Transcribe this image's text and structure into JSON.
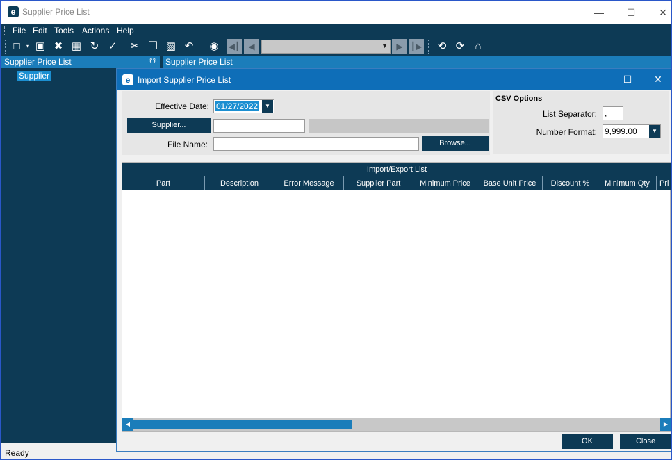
{
  "window": {
    "title": "Supplier Price List",
    "logo": "e"
  },
  "menu": [
    "File",
    "Edit",
    "Tools",
    "Actions",
    "Help"
  ],
  "panels": {
    "left": "Supplier Price List",
    "right": "Supplier Price List"
  },
  "tree": {
    "node": "Supplier"
  },
  "status": "Ready",
  "dialog": {
    "title": "Import Supplier Price List",
    "effective_date_label": "Effective Date:",
    "effective_date": "01/27/2022",
    "supplier_button": "Supplier...",
    "supplier_value": "",
    "supplier_name": "",
    "file_name_label": "File Name:",
    "file_name": "",
    "browse_button": "Browse...",
    "csv": {
      "header": "CSV Options",
      "separator_label": "List Separator:",
      "separator": ",",
      "format_label": "Number Format:",
      "format": "9,999.00"
    },
    "grid": {
      "caption": "Import/Export List",
      "columns": [
        "Part",
        "Description",
        "Error Message",
        "Supplier Part",
        "Minimum Price",
        "Base Unit Price",
        "Discount %",
        "Minimum Qty",
        "Pri"
      ]
    },
    "ok_button": "OK",
    "close_button": "Close"
  }
}
